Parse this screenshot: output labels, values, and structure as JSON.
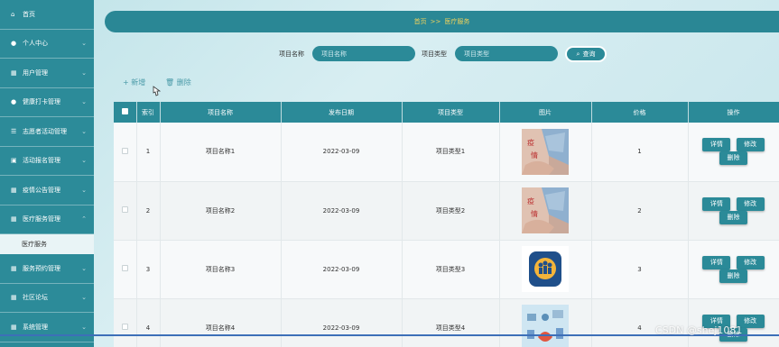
{
  "sidebar": {
    "items": [
      {
        "label": "首页",
        "icon": "home-icon",
        "glyph": "⌂"
      },
      {
        "label": "个人中心",
        "icon": "user-icon",
        "glyph": "●"
      },
      {
        "label": "用户管理",
        "icon": "grid-icon",
        "glyph": "▦"
      },
      {
        "label": "健康打卡管理",
        "icon": "user-icon",
        "glyph": "●"
      },
      {
        "label": "志愿者活动管理",
        "icon": "sliders-icon",
        "glyph": "☰"
      },
      {
        "label": "活动报名管理",
        "icon": "document-icon",
        "glyph": "▣"
      },
      {
        "label": "疫情公告管理",
        "icon": "grid-icon",
        "glyph": "▦"
      },
      {
        "label": "医疗服务管理",
        "icon": "grid-icon",
        "glyph": "▦"
      }
    ],
    "active_sub": "医疗服务",
    "items_after": [
      {
        "label": "服务预约管理",
        "icon": "grid-icon",
        "glyph": "▦"
      },
      {
        "label": "社区论坛",
        "icon": "grid-icon",
        "glyph": "▦"
      },
      {
        "label": "系统管理",
        "icon": "grid-icon",
        "glyph": "▦"
      }
    ]
  },
  "breadcrumb": {
    "home": "首页",
    "separator": ">>",
    "current": "医疗服务"
  },
  "search": {
    "name_label": "项目名称",
    "name_placeholder": "项目名称",
    "type_label": "项目类型",
    "type_placeholder": "项目类型",
    "query_button": "查询"
  },
  "actions": {
    "add": "+ 新增",
    "delete": "删除"
  },
  "table": {
    "headers": [
      "索引",
      "项目名称",
      "发布日期",
      "项目类型",
      "图片",
      "价格",
      "操作"
    ],
    "rows": [
      {
        "index": "1",
        "name": "项目名称1",
        "date": "2022-03-09",
        "type": "项目类型1",
        "image": "mask-hands-photo",
        "price": "1"
      },
      {
        "index": "2",
        "name": "项目名称2",
        "date": "2022-03-09",
        "type": "项目类型2",
        "image": "mask-hands-photo",
        "price": "2"
      },
      {
        "index": "3",
        "name": "项目名称3",
        "date": "2022-03-09",
        "type": "项目类型3",
        "image": "family-app-icon",
        "price": "3"
      },
      {
        "index": "4",
        "name": "项目名称4",
        "date": "2022-03-09",
        "type": "项目类型4",
        "image": "medical-illustration",
        "price": "4"
      }
    ],
    "buttons": {
      "detail": "详情",
      "edit": "修改",
      "delete": "删除"
    }
  },
  "watermark": "CSDN @shej1081",
  "colors": {
    "primary": "#2b8a98",
    "breadcrumb_text": "#f0d25a",
    "link": "#4a9aa8"
  }
}
